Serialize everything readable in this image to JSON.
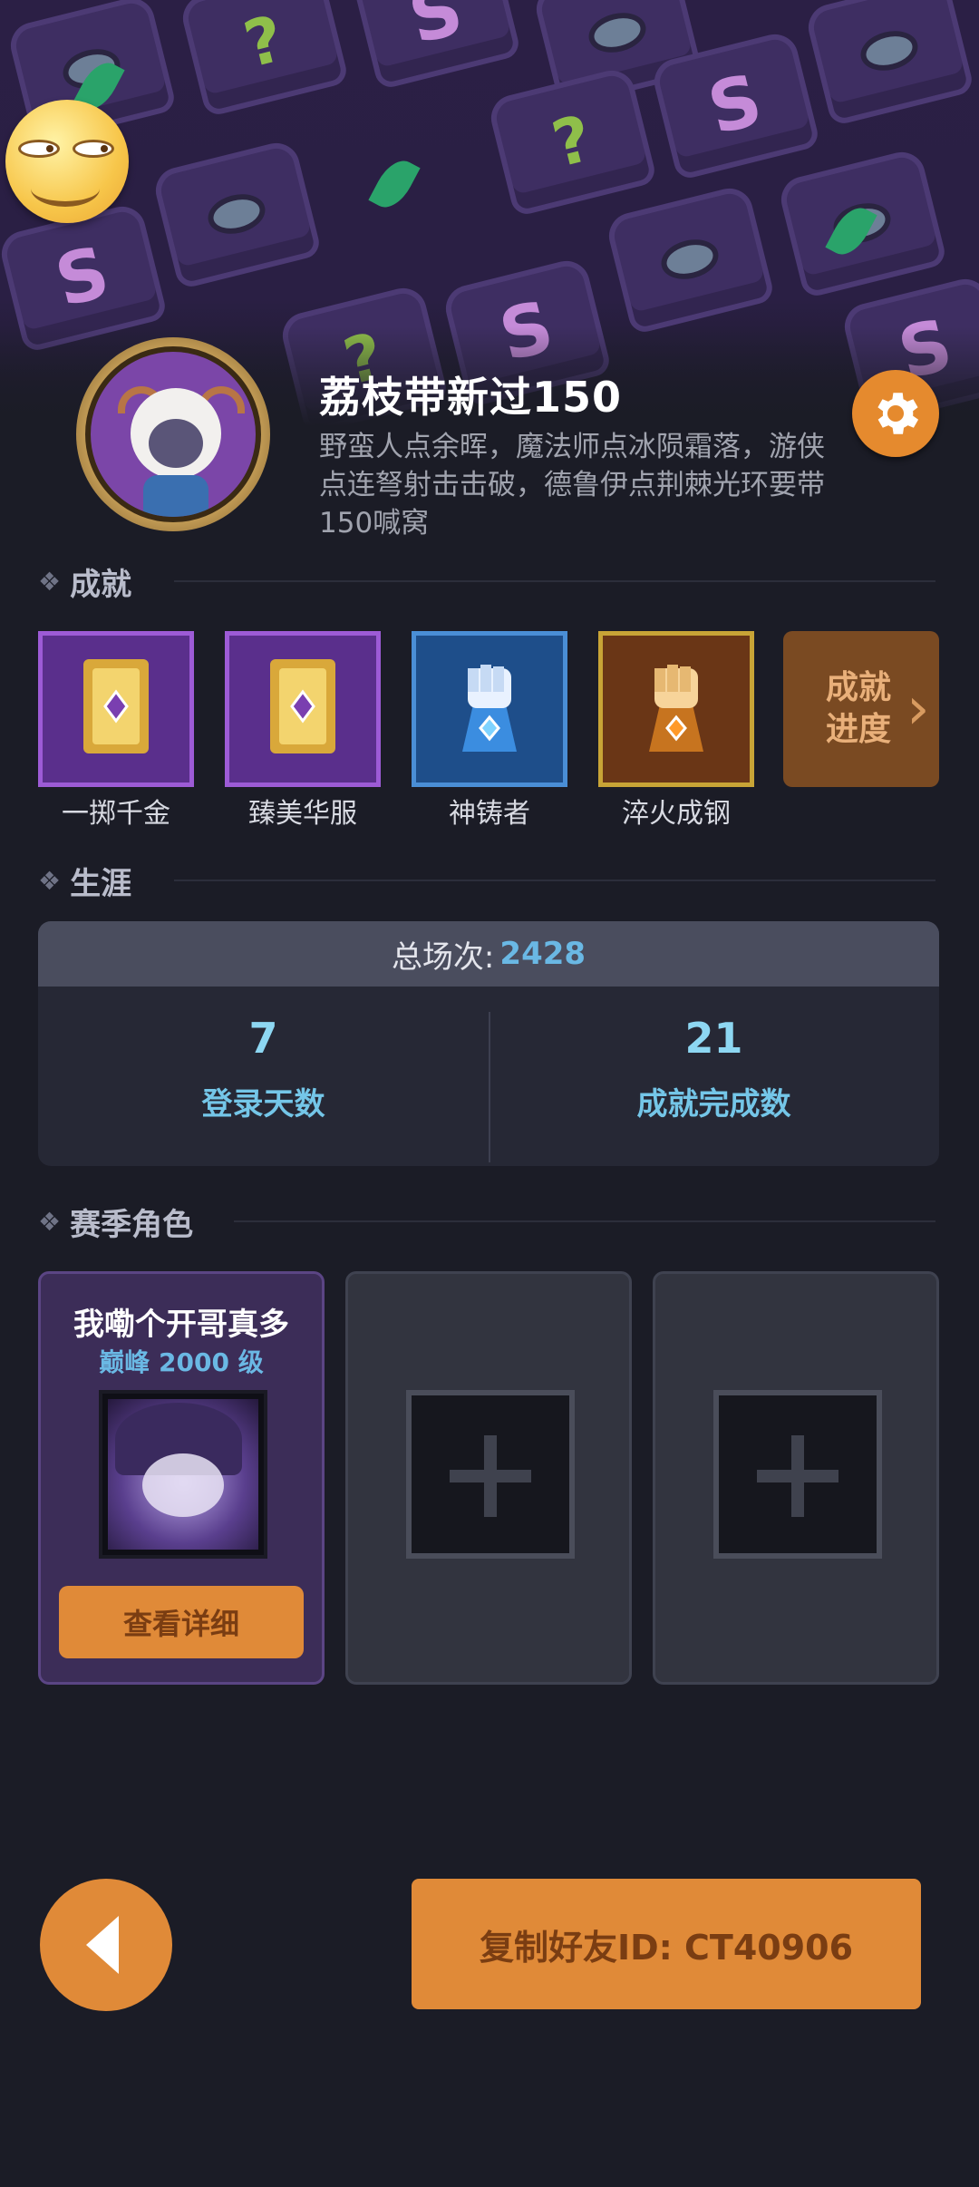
{
  "profile": {
    "name": "荔枝带新过150",
    "bio": "野蛮人点余晖，魔法师点冰陨霜落，游侠点连弩射击击破，德鲁伊点荆棘光环要带150喊窝"
  },
  "achievements": {
    "section_title": "成就",
    "items": [
      {
        "label": "一掷千金",
        "tier": "purple"
      },
      {
        "label": "臻美华服",
        "tier": "purple"
      },
      {
        "label": "神铸者",
        "tier": "blue"
      },
      {
        "label": "淬火成钢",
        "tier": "gold"
      }
    ],
    "progress_label_line1": "成就",
    "progress_label_line2": "进度"
  },
  "career": {
    "section_title": "生涯",
    "total_label": "总场次:",
    "total_value": "2428",
    "stats": [
      {
        "value": "7",
        "label": "登录天数"
      },
      {
        "value": "21",
        "label": "成就完成数"
      }
    ]
  },
  "season_roles": {
    "section_title": "赛季角色",
    "filled": {
      "name": "我嘞个开哥真多",
      "level": "巅峰 2000 级",
      "button": "查看详细"
    }
  },
  "footer": {
    "copy_button": "复制好友ID: CT40906"
  },
  "icons": {
    "settings": "gear-icon",
    "back": "arrow-left-icon",
    "add": "plus-icon"
  },
  "colors": {
    "accent": "#e08a38",
    "highlight_blue": "#6ab8e4",
    "background": "#1b1c26"
  }
}
